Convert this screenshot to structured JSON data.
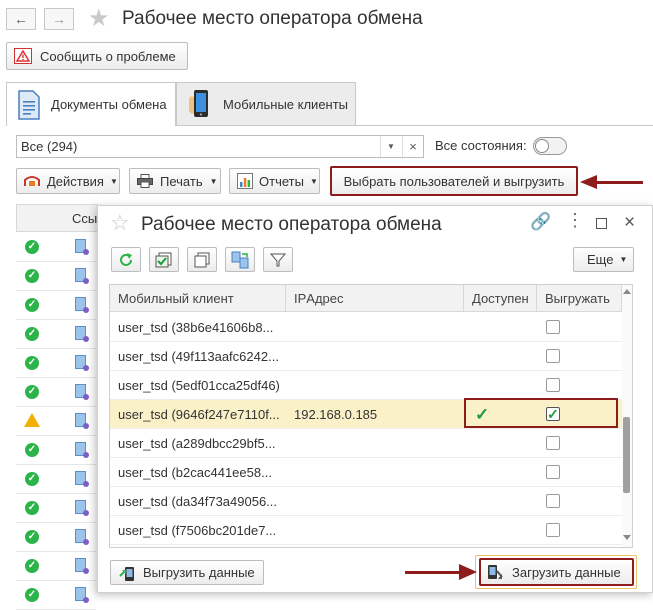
{
  "main": {
    "title": "Рабочее место оператора обмена",
    "report_button": "Сообщить о проблеме",
    "tabs": [
      {
        "label": "Документы обмена"
      },
      {
        "label": "Мобильные клиенты"
      }
    ],
    "filter_value": "Все (294)",
    "all_states_label": "Все состояния:",
    "toolbar": {
      "actions": "Действия",
      "print": "Печать",
      "reports": "Отчеты",
      "select_users": "Выбрать пользователей и выгрузить"
    },
    "left_column_header": "Ссы",
    "left_rows": [
      "ok",
      "ok",
      "ok",
      "ok",
      "ok",
      "ok",
      "warn",
      "ok",
      "ok",
      "ok",
      "ok",
      "ok",
      "ok"
    ]
  },
  "modal": {
    "title": "Рабочее место оператора обмена",
    "more_button": "Еще",
    "columns": {
      "client": "Мобильный клиент",
      "ip": "IPАдрес",
      "available": "Доступен",
      "upload": "Выгружать"
    },
    "rows": [
      {
        "client": "user_tsd (38b6e41606b8...",
        "ip": "",
        "available": false,
        "upload": false
      },
      {
        "client": "user_tsd (49f113aafc6242...",
        "ip": "",
        "available": false,
        "upload": false
      },
      {
        "client": "user_tsd (5edf01cca25df46)",
        "ip": "",
        "available": false,
        "upload": false
      },
      {
        "client": "user_tsd (9646f247e7110f...",
        "ip": "192.168.0.185",
        "available": true,
        "upload": true
      },
      {
        "client": "user_tsd (a289dbcc29bf5...",
        "ip": "",
        "available": false,
        "upload": false
      },
      {
        "client": "user_tsd (b2cac441ee58...",
        "ip": "",
        "available": false,
        "upload": false
      },
      {
        "client": "user_tsd (da34f73a49056...",
        "ip": "",
        "available": false,
        "upload": false
      },
      {
        "client": "user_tsd (f7506bc201de7...",
        "ip": "",
        "available": false,
        "upload": false
      }
    ],
    "upload_button": "Выгрузить данные",
    "load_button": "Загрузить данные"
  },
  "colors": {
    "highlight_red": "#8e1c1c",
    "selected_row": "#fbf1c9",
    "ok_green": "#2cb34a",
    "warn_yellow": "#f2b100"
  }
}
